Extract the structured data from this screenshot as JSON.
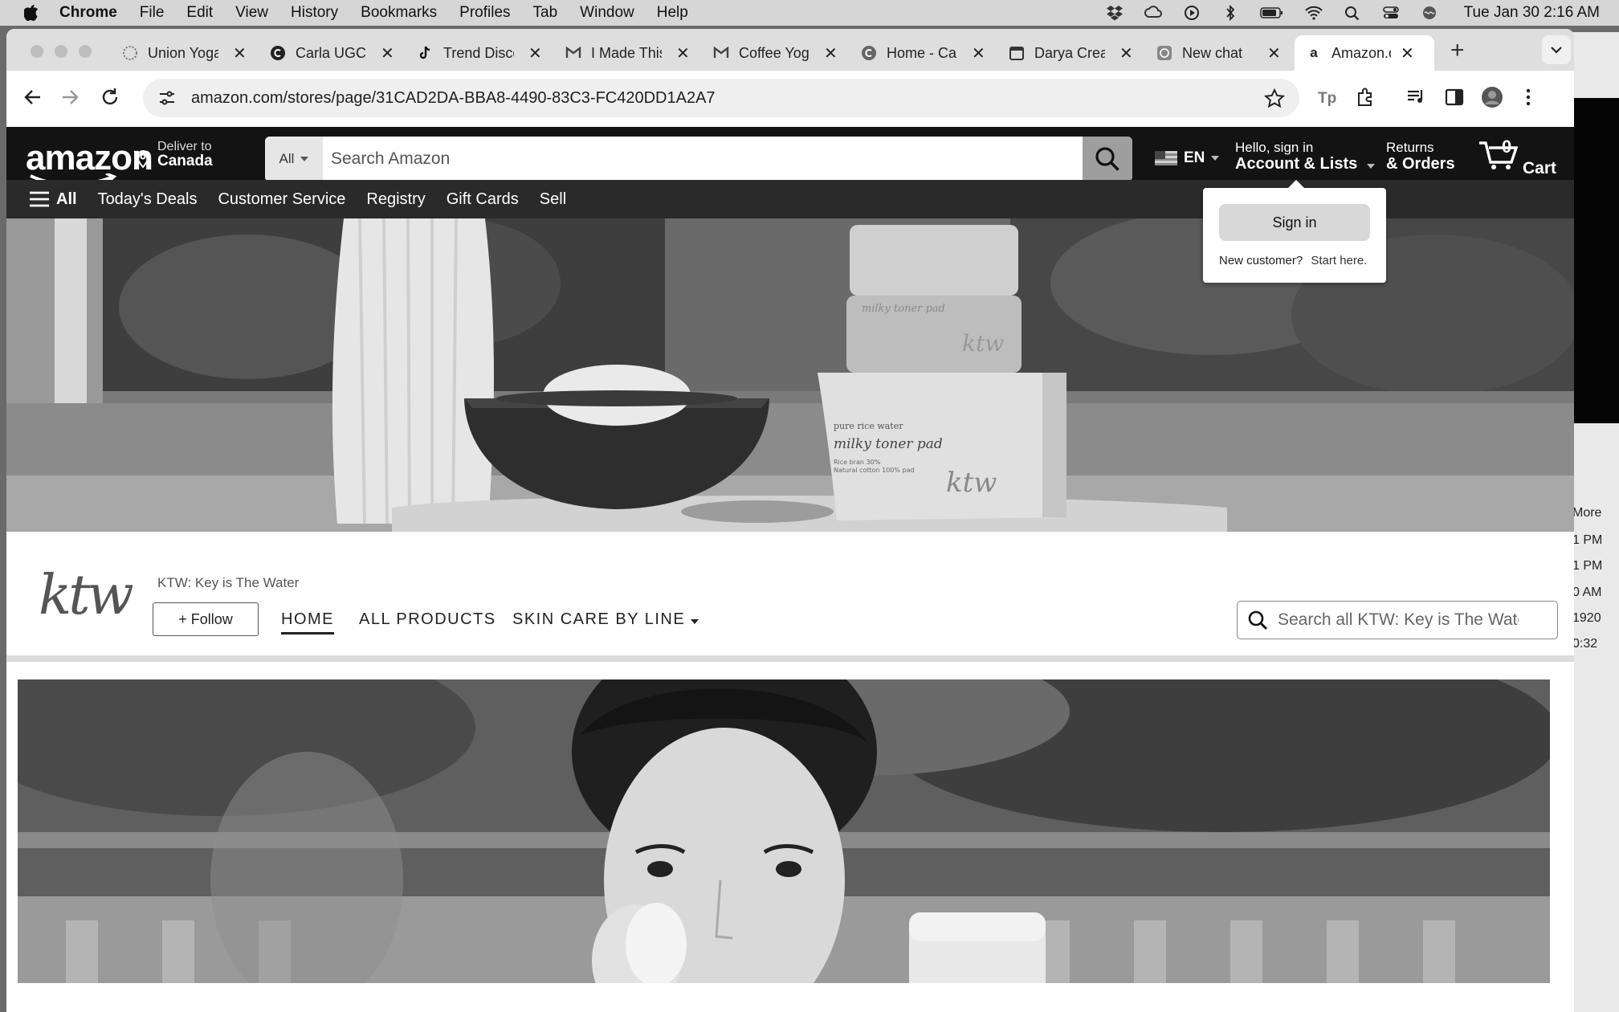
{
  "menubar": {
    "app": "Chrome",
    "items": [
      "File",
      "Edit",
      "View",
      "History",
      "Bookmarks",
      "Profiles",
      "Tab",
      "Window",
      "Help"
    ],
    "clock": "Tue Jan 30  2:16 AM"
  },
  "tabs": [
    {
      "title": "Union Yoga",
      "icon": "union-yoga-favicon"
    },
    {
      "title": "Carla UGC",
      "icon": "c-favicon"
    },
    {
      "title": "Trend Disco",
      "icon": "tiktok-favicon"
    },
    {
      "title": "I Made This",
      "icon": "gmail-favicon"
    },
    {
      "title": "Coffee Yoga",
      "icon": "gmail-favicon"
    },
    {
      "title": "Home - Ca",
      "icon": "c-favicon"
    },
    {
      "title": "Darya Crea",
      "icon": "calendar-favicon"
    },
    {
      "title": "New chat",
      "icon": "chatgpt-favicon"
    },
    {
      "title": "Amazon.ca",
      "icon": "amazon-favicon",
      "active": true
    }
  ],
  "toolbar": {
    "url": "amazon.com/stores/page/31CAD2DA-BBA8-4490-83C3-FC420DD1A2A7"
  },
  "amazon": {
    "logo": "amazon",
    "deliver_label": "Deliver to",
    "deliver_country": "Canada",
    "search_category": "All",
    "search_placeholder": "Search Amazon",
    "language": "EN",
    "hello": "Hello, sign in",
    "account_lists": "Account & Lists",
    "returns": "Returns",
    "orders": "& Orders",
    "cart_count": "0",
    "cart_label": "Cart",
    "nav": {
      "all": "All",
      "items": [
        "Today's Deals",
        "Customer Service",
        "Registry",
        "Gift Cards",
        "Sell"
      ]
    },
    "flyout": {
      "sign_in": "Sign in",
      "new_customer": "New customer?",
      "start_here": "Start here."
    }
  },
  "hero": {
    "box_line1": "pure rice water",
    "box_line2": "milky toner pad",
    "box_line3": "Rice bran 30%",
    "box_line4": "Natural cotton 100% pad",
    "jar_label": "milky toner pad",
    "brand_mark": "ktw"
  },
  "store": {
    "logo": "ktw",
    "name": "KTW: Key is The Water",
    "follow": "+ Follow",
    "tabs": [
      "HOME",
      "ALL PRODUCTS",
      "SKIN CARE BY LINE"
    ],
    "search_placeholder": "Search all KTW: Key is The Water"
  },
  "background_window": {
    "lines": [
      "More",
      "1 PM",
      "1 PM",
      "0 AM",
      "1920",
      "0:32"
    ]
  }
}
